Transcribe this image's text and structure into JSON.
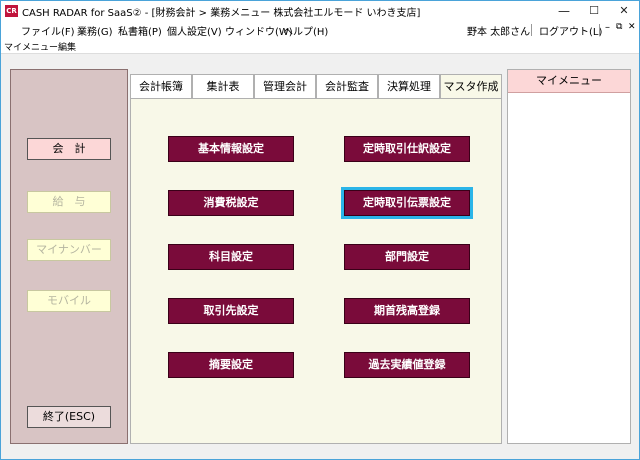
{
  "window": {
    "app_icon_text": "CR",
    "title": "CASH RADAR for SaaS② - [財務会計 > 業務メニュー 株式会社エルモード いわき支店]",
    "minimize": "—",
    "maximize": "☐",
    "close": "✕"
  },
  "menubar": {
    "items": [
      "ファイル(F)",
      "業務(G)",
      "私書箱(P)",
      "個人設定(V)",
      "ウィンドウ(W)",
      "ヘルプ(H)"
    ],
    "user": "野本 太郎さん",
    "logout": "ログアウト(L)",
    "mdi_min": "–",
    "mdi_restore": "⧉",
    "mdi_close": "✕"
  },
  "subbar": {
    "title": "マイメニュー編集"
  },
  "sidebar": {
    "items": [
      {
        "label": "会　計",
        "state": "active"
      },
      {
        "label": "給　与",
        "state": "disabled"
      },
      {
        "label": "マイナンバー",
        "state": "disabled"
      },
      {
        "label": "モバイル",
        "state": "disabled"
      }
    ],
    "exit_label": "終了(ESC)"
  },
  "tabs": [
    {
      "label": "会計帳簿"
    },
    {
      "label": "集計表"
    },
    {
      "label": "管理会計"
    },
    {
      "label": "会計監査"
    },
    {
      "label": "決算処理"
    },
    {
      "label": "マスタ作成",
      "active": true
    }
  ],
  "buttons": {
    "left": [
      "基本情報設定",
      "消費税設定",
      "科目設定",
      "取引先設定",
      "摘要設定"
    ],
    "right": [
      "定時取引仕訳設定",
      "定時取引伝票設定",
      "部門設定",
      "期首残高登録",
      "過去実績値登録"
    ]
  },
  "mymenu": {
    "title": "マイメニュー"
  },
  "colors": {
    "accent": "#7a0b3a",
    "selection": "#2bb5e8",
    "sidebar_bg": "#d8c4c4",
    "active_side": "#fcd7d7",
    "tab_panel_bg": "#f8f8e8"
  }
}
